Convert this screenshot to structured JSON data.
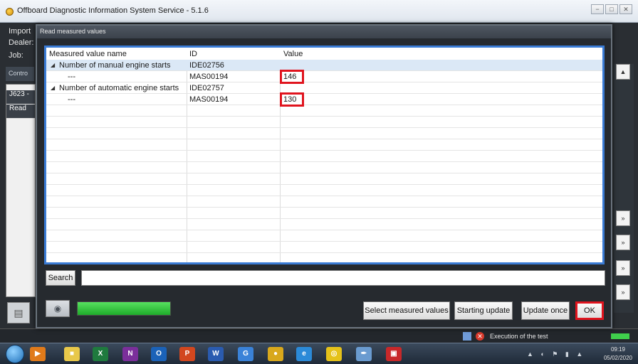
{
  "window": {
    "title": "Offboard Diagnostic Information System Service - 5.1.6",
    "buttons": [
      "−",
      "□",
      "✕"
    ]
  },
  "background": {
    "labels": [
      "Import",
      "Dealer:",
      "Job:"
    ],
    "strip_label": "Contro",
    "panel_rows": [
      "J623 -",
      "Read"
    ],
    "bottom_status": "Execution of the test"
  },
  "dialog": {
    "title": "Read measured values",
    "columns": {
      "name": "Measured value name",
      "id": "ID",
      "value": "Value"
    },
    "rows": [
      {
        "type": "group",
        "name": "Number of manual engine starts",
        "id": "IDE02756",
        "value": ""
      },
      {
        "type": "item",
        "name": "---",
        "id": "MAS00194",
        "value": "146"
      },
      {
        "type": "group",
        "name": "Number of automatic engine starts",
        "id": "IDE02757",
        "value": ""
      },
      {
        "type": "item",
        "name": "---",
        "id": "MAS00194",
        "value": "130"
      }
    ],
    "search": {
      "button_label": "Search",
      "value": ""
    },
    "progress": 1.0,
    "buttons": {
      "select_measured_values": "Select measured values",
      "starting_update": "Starting update",
      "update_once": "Update once",
      "ok": "OK"
    }
  },
  "taskbar": {
    "apps": [
      {
        "icon": "media-player-icon",
        "glyph": "▶",
        "color": "#e07a1a"
      },
      {
        "icon": "file-explorer-icon",
        "glyph": "■",
        "color": "#e8c84a"
      },
      {
        "icon": "excel-icon",
        "glyph": "X",
        "color": "#1f7a3e"
      },
      {
        "icon": "onenote-icon",
        "glyph": "N",
        "color": "#7b2f9b"
      },
      {
        "icon": "outlook-icon",
        "glyph": "O",
        "color": "#1b62b8"
      },
      {
        "icon": "powerpoint-icon",
        "glyph": "P",
        "color": "#d2471f"
      },
      {
        "icon": "word-icon",
        "glyph": "W",
        "color": "#2a5bb0"
      },
      {
        "icon": "google-icon",
        "glyph": "G",
        "color": "#3a82d8"
      },
      {
        "icon": "chrome-icon",
        "glyph": "●",
        "color": "#d8a81c"
      },
      {
        "icon": "internet-explorer-icon",
        "glyph": "e",
        "color": "#2b8ad8"
      },
      {
        "icon": "odis-icon",
        "glyph": "◎",
        "color": "#e5c21a"
      },
      {
        "icon": "paint-icon",
        "glyph": "✒",
        "color": "#6a9bd0"
      },
      {
        "icon": "network-app-icon",
        "glyph": "▣",
        "color": "#c8282a"
      }
    ],
    "clock": {
      "time": "09:19",
      "date": "05/02/2020"
    }
  }
}
